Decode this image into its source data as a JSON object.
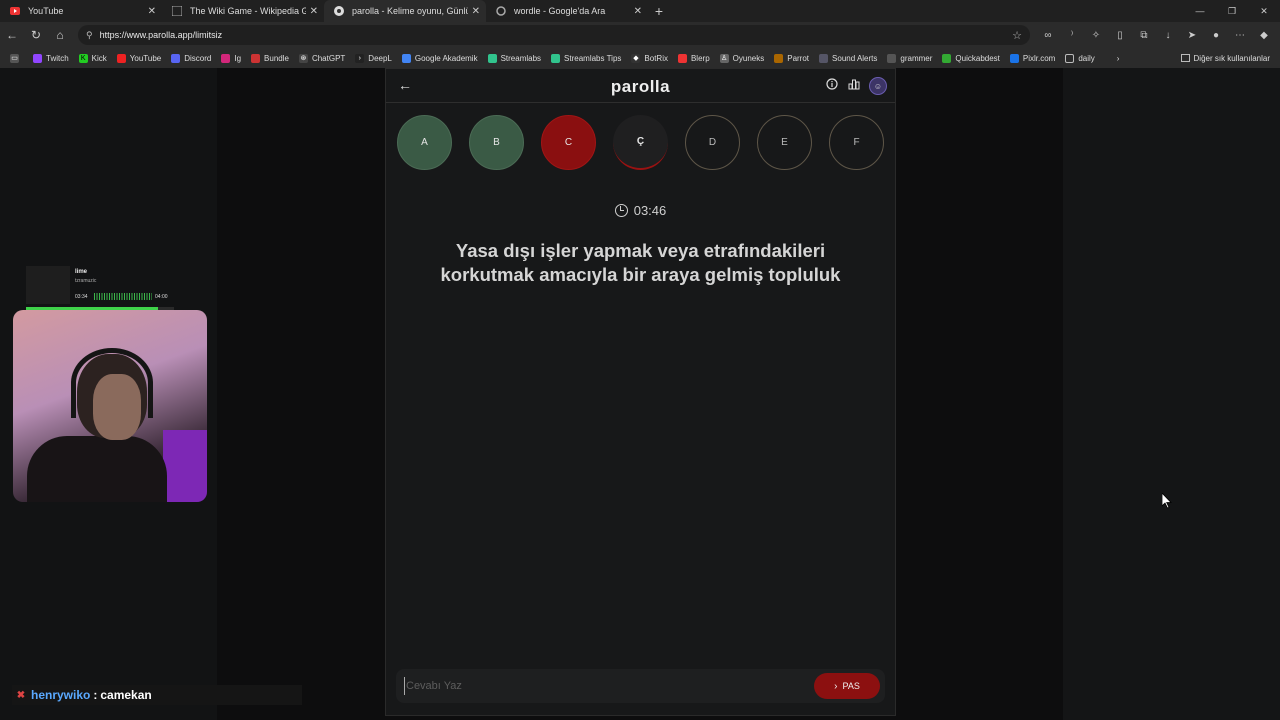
{
  "browser": {
    "tabs": [
      {
        "title": "YouTube",
        "icon": "youtube-icon",
        "active": false
      },
      {
        "title": "The Wiki Game - Wikipedia Game",
        "icon": "wiki-icon",
        "active": false
      },
      {
        "title": "parolla - Kelime oyunu, Günlük k",
        "icon": "parolla-icon",
        "active": true
      },
      {
        "title": "wordle - Google'da Ara",
        "icon": "google-icon",
        "active": false
      }
    ],
    "url": "https://www.parolla.app/limitsiz",
    "bookmarks": [
      "Twitch",
      "Kick",
      "YouTube",
      "Discord",
      "Ig",
      "Bundle",
      "ChatGPT",
      "DeepL",
      "Google Akademik",
      "Streamlabs",
      "Streamlabs Tips",
      "BotRix",
      "Blerp",
      "Oyuneks",
      "Parrot",
      "Sound Alerts",
      "grammer",
      "Quickabdest",
      "Pixlr.com",
      "daily"
    ],
    "bookmarks_other": "Diğer sık kullanılanlar"
  },
  "app": {
    "logo": "parolla",
    "letters": [
      {
        "letter": "A",
        "state": "correct"
      },
      {
        "letter": "B",
        "state": "correct"
      },
      {
        "letter": "C",
        "state": "wrong"
      },
      {
        "letter": "Ç",
        "state": "current"
      },
      {
        "letter": "D",
        "state": "pending"
      },
      {
        "letter": "E",
        "state": "pending"
      },
      {
        "letter": "F",
        "state": "pending"
      }
    ],
    "timer": "03:46",
    "question": "Yasa dışı işler yapmak veya etrafındakileri korkutmak amacıyla bir araya gelmiş topluluk",
    "answer_placeholder": "Cevabı Yaz",
    "pas_label": "PAS",
    "colors": {
      "correct": "#3a5a45",
      "wrong": "#8a0f10",
      "accent": "#8c1010"
    }
  },
  "overlay": {
    "now_playing": {
      "title": "lime",
      "artist": "tzramuzic",
      "elapsed": "03:34",
      "total": "04:00",
      "progress": 0.89
    },
    "chat": {
      "user": "henrywiko",
      "separator": ":",
      "message": "camekan"
    }
  }
}
